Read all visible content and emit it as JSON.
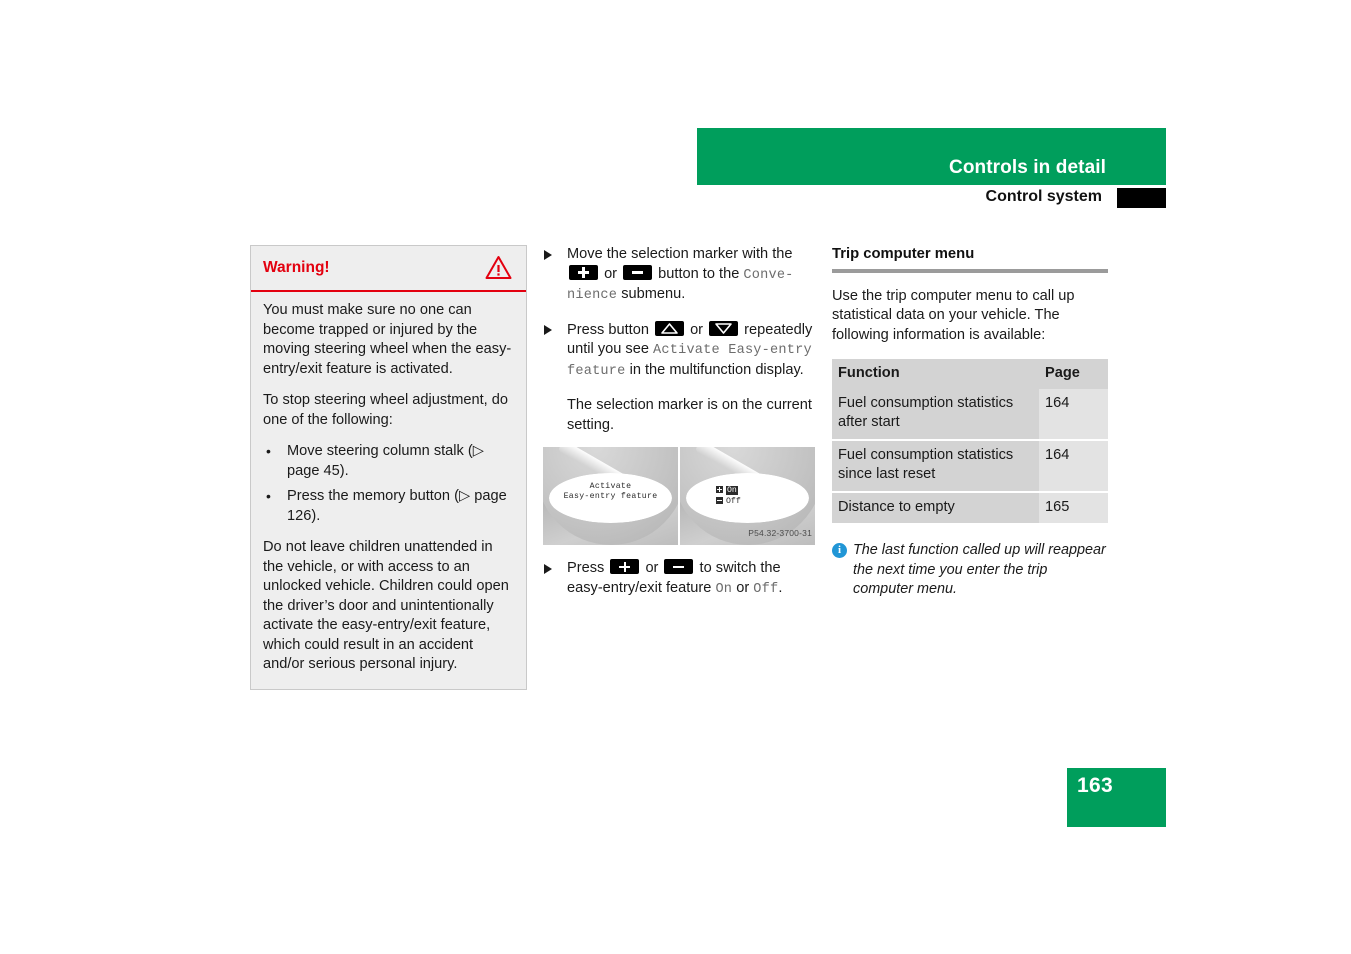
{
  "header": {
    "title": "Controls in detail",
    "subtitle": "Control system"
  },
  "warning": {
    "title": "Warning!",
    "icon": "warning-triangle-icon",
    "paragraph1": "You must make sure no one can become trapped or injured by the moving steering wheel when the easy-entry/exit feature is activated.",
    "paragraph2": "To stop steering wheel adjustment, do one of the following:",
    "bullets": [
      "Move steering column stalk (▷ page 45).",
      "Press the memory button (▷ page 126)."
    ],
    "paragraph3": "Do not leave children unattended in the vehicle, or with access to an unlocked vehicle. Children could open the driver’s door and unintentionally activate the easy-entry/exit feature, which could result in an accident and/or serious personal injury."
  },
  "steps": {
    "step1": {
      "part1": "Move the selection marker with the",
      "key_plus": "plus-button-icon",
      "or": "or",
      "key_minus": "minus-button-icon",
      "part2": "button to the",
      "display_text": "Conve-nience",
      "part3": "submenu."
    },
    "step2": {
      "part1": "Press button",
      "key_up": "up-arrow-button-icon",
      "or": "or",
      "key_down": "down-arrow-button-icon",
      "part2": "repeatedly until you see",
      "display_text": "Activate Easy-entry feature",
      "part3": "in the multifunction display."
    },
    "note": "The selection marker is on the current setting.",
    "step3": {
      "part1": "Press",
      "key_plus": "plus-button-icon",
      "or": "or",
      "key_minus": "minus-button-icon",
      "part2": "to switch the easy-entry/exit feature",
      "on": "On",
      "middle": "or",
      "off": "Off",
      "period": "."
    }
  },
  "figure": {
    "left_screen_line1": "Activate",
    "left_screen_line2": "Easy-entry feature",
    "right_option_on": "On",
    "right_option_off": "Off",
    "caption": "P54.32-3700-31"
  },
  "trip_computer": {
    "title": "Trip computer menu",
    "intro": "Use the trip computer menu to call up statistical data on your vehicle. The following information is available:",
    "table": {
      "headers": [
        "Function",
        "Page"
      ],
      "rows": [
        {
          "function": "Fuel consumption statistics after start",
          "page": "164"
        },
        {
          "function": "Fuel consumption statistics since last reset",
          "page": "164"
        },
        {
          "function": "Distance to empty",
          "page": "165"
        }
      ]
    },
    "note": "The last function called up will reappear the next time you enter the trip computer menu.",
    "note_icon": "info-icon"
  },
  "page_number": "163",
  "colors": {
    "accent_green": "#009E5C",
    "warning_red": "#e3000f",
    "info_blue": "#2196d6",
    "rule_gray": "#9b9b9b"
  }
}
